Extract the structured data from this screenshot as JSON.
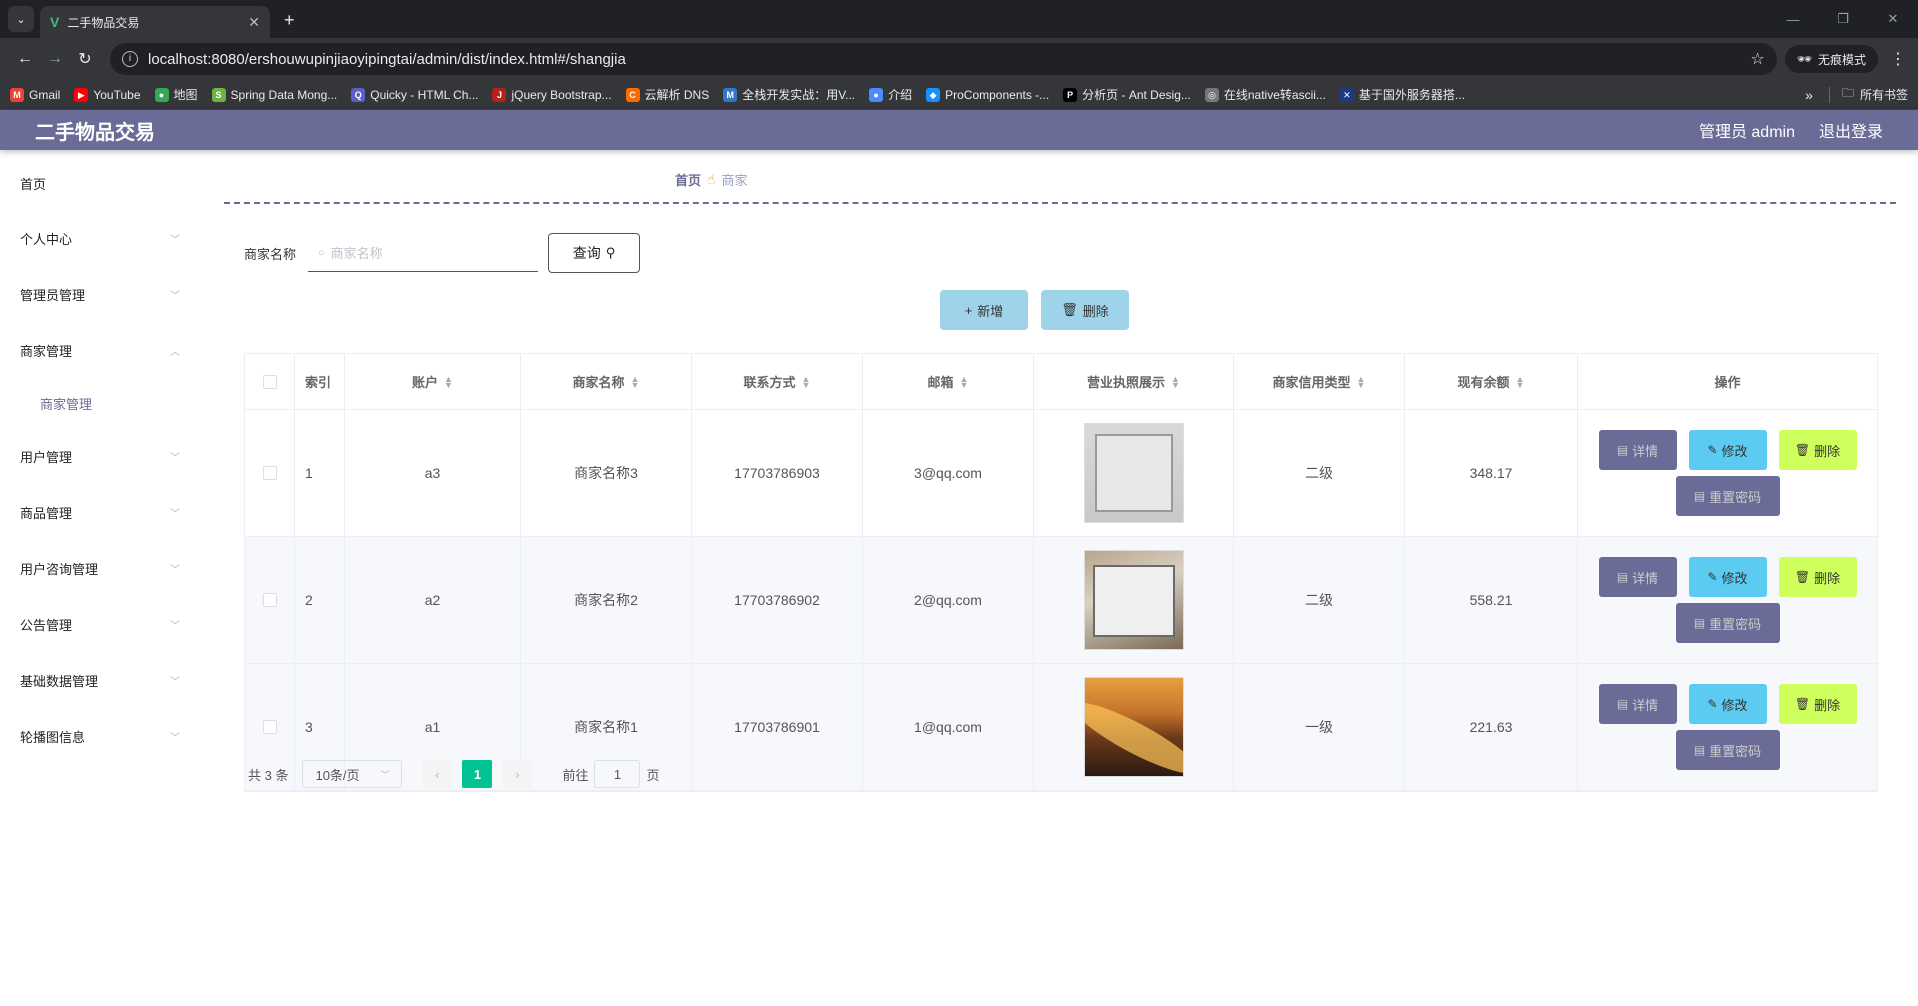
{
  "browser": {
    "tab_title": "二手物品交易",
    "url": "localhost:8080/ershouwupinjiaoyipingtai/admin/dist/index.html#/shangjia",
    "incognito": "无痕模式",
    "bookmarks": [
      {
        "label": "Gmail",
        "color": "#ea4335",
        "icon": "M"
      },
      {
        "label": "YouTube",
        "color": "#ff0000",
        "icon": "▶"
      },
      {
        "label": "地图",
        "color": "#34a853",
        "icon": "●"
      },
      {
        "label": "Spring Data Mong...",
        "color": "#6db33f",
        "icon": "S"
      },
      {
        "label": "Quicky - HTML Ch...",
        "color": "#5b5fc7",
        "icon": "Q"
      },
      {
        "label": "jQuery Bootstrap...",
        "color": "#b3231d",
        "icon": "J"
      },
      {
        "label": "云解析 DNS",
        "color": "#ff6a00",
        "icon": "C"
      },
      {
        "label": "全栈开发实战：用V...",
        "color": "#3178c6",
        "icon": "M"
      },
      {
        "label": "介绍",
        "color": "#4a8cff",
        "icon": "●"
      },
      {
        "label": "ProComponents -...",
        "color": "#1890ff",
        "icon": "◆"
      },
      {
        "label": "分析页 - Ant Desig...",
        "color": "#000000",
        "icon": "P"
      },
      {
        "label": "在线native转ascii...",
        "color": "#777777",
        "icon": "◎"
      },
      {
        "label": "基于国外服务器搭...",
        "color": "#1d3a8a",
        "icon": "✕"
      }
    ],
    "all_bookmarks": "所有书签"
  },
  "header": {
    "title": "二手物品交易",
    "admin": "管理员 admin",
    "logout": "退出登录"
  },
  "sidebar": {
    "items": [
      {
        "label": "首页"
      },
      {
        "label": "个人中心"
      },
      {
        "label": "管理员管理"
      },
      {
        "label": "商家管理"
      },
      {
        "label": "用户管理"
      },
      {
        "label": "商品管理"
      },
      {
        "label": "用户咨询管理"
      },
      {
        "label": "公告管理"
      },
      {
        "label": "基础数据管理"
      },
      {
        "label": "轮播图信息"
      }
    ],
    "sub_item": "商家管理"
  },
  "breadcrumb": {
    "home": "首页",
    "current": "商家"
  },
  "search": {
    "label": "商家名称",
    "placeholder": "商家名称",
    "query_button": "查询"
  },
  "actions": {
    "add": "新增",
    "delete": "删除"
  },
  "table": {
    "headers": [
      "索引",
      "账户",
      "商家名称",
      "联系方式",
      "邮箱",
      "营业执照展示",
      "商家信用类型",
      "现有余额",
      "操作"
    ],
    "rows": [
      {
        "index": "1",
        "account": "a3",
        "name": "商家名称3",
        "phone": "17703786903",
        "email": "3@qq.com",
        "credit": "二级",
        "balance": "348.17"
      },
      {
        "index": "2",
        "account": "a2",
        "name": "商家名称2",
        "phone": "17703786902",
        "email": "2@qq.com",
        "credit": "二级",
        "balance": "558.21"
      },
      {
        "index": "3",
        "account": "a1",
        "name": "商家名称1",
        "phone": "17703786901",
        "email": "1@qq.com",
        "credit": "一级",
        "balance": "221.63"
      }
    ],
    "ops": {
      "detail": "详情",
      "edit": "修改",
      "delete": "删除",
      "reset": "重置密码"
    }
  },
  "pagination": {
    "total": "共 3 条",
    "page_size": "10条/页",
    "current_page": "1",
    "goto_label": "前往",
    "goto_value": "1",
    "goto_suffix": "页"
  }
}
